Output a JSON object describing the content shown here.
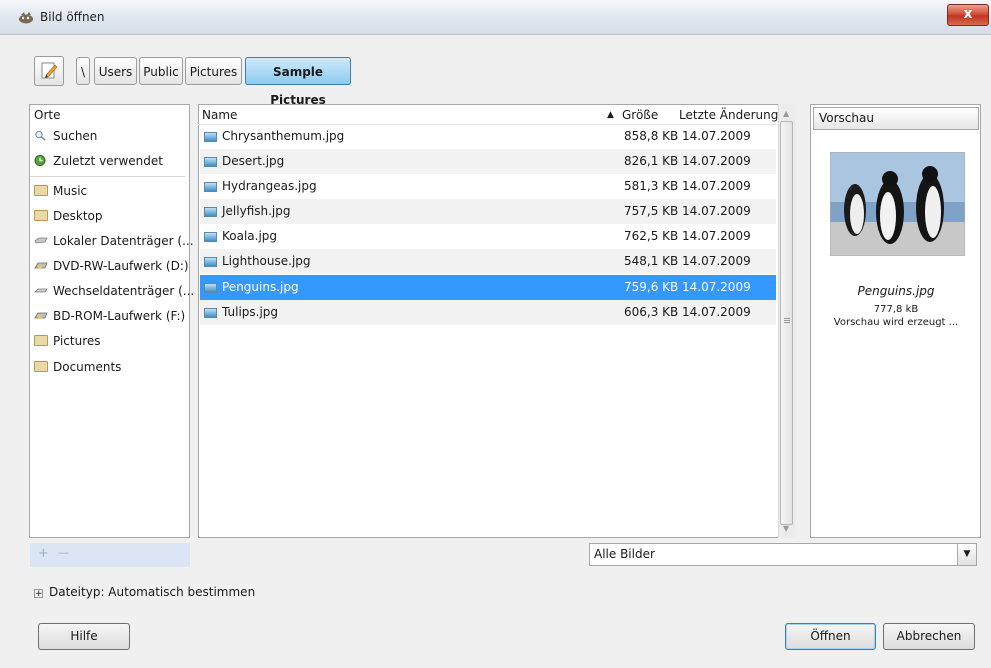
{
  "window": {
    "title": "Bild öffnen",
    "close_label": "x"
  },
  "breadcrumb": {
    "root": "\\",
    "items": [
      "Users",
      "Public",
      "Pictures",
      "Sample Pictures"
    ],
    "active_index": 3
  },
  "places": {
    "header": "Orte",
    "items": [
      {
        "label": "Suchen",
        "icon": "search-icon"
      },
      {
        "label": "Zuletzt verwendet",
        "icon": "recent-icon"
      },
      {
        "label": "Music",
        "icon": "folder-icon"
      },
      {
        "label": "Desktop",
        "icon": "folder-icon"
      },
      {
        "label": "Lokaler Datenträger (...",
        "icon": "harddisk-icon"
      },
      {
        "label": "DVD-RW-Laufwerk (D:)",
        "icon": "optical-drive-icon"
      },
      {
        "label": "Wechseldatenträger (...",
        "icon": "removable-drive-icon"
      },
      {
        "label": "BD-ROM-Laufwerk (F:)",
        "icon": "optical-drive-icon"
      },
      {
        "label": "Pictures",
        "icon": "folder-icon"
      },
      {
        "label": "Documents",
        "icon": "folder-icon"
      }
    ],
    "add_label": "+",
    "remove_label": "—"
  },
  "files": {
    "columns": {
      "name": "Name",
      "size": "Größe",
      "modified": "Letzte Änderung"
    },
    "sort_indicator": "▲",
    "rows": [
      {
        "name": "Chrysanthemum.jpg",
        "size": "858,8 KB",
        "modified": "14.07.2009"
      },
      {
        "name": "Desert.jpg",
        "size": "826,1 KB",
        "modified": "14.07.2009"
      },
      {
        "name": "Hydrangeas.jpg",
        "size": "581,3 KB",
        "modified": "14.07.2009"
      },
      {
        "name": "Jellyfish.jpg",
        "size": "757,5 KB",
        "modified": "14.07.2009"
      },
      {
        "name": "Koala.jpg",
        "size": "762,5 KB",
        "modified": "14.07.2009"
      },
      {
        "name": "Lighthouse.jpg",
        "size": "548,1 KB",
        "modified": "14.07.2009"
      },
      {
        "name": "Penguins.jpg",
        "size": "759,6 KB",
        "modified": "14.07.2009"
      },
      {
        "name": "Tulips.jpg",
        "size": "606,3 KB",
        "modified": "14.07.2009"
      }
    ],
    "selected_index": 6
  },
  "preview": {
    "header": "Vorschau",
    "filename": "Penguins.jpg",
    "size": "777,8 kB",
    "status": "Vorschau wird erzeugt ..."
  },
  "filter": {
    "value": "Alle Bilder",
    "arrow": "▼"
  },
  "filetype": {
    "label": "Dateityp: Automatisch bestimmen",
    "expander": "+"
  },
  "buttons": {
    "help": "Hilfe",
    "open": "Öffnen",
    "cancel": "Abbrechen"
  },
  "colors": {
    "selection": "#3399ff",
    "active_crumb": "#8ccbf0"
  }
}
